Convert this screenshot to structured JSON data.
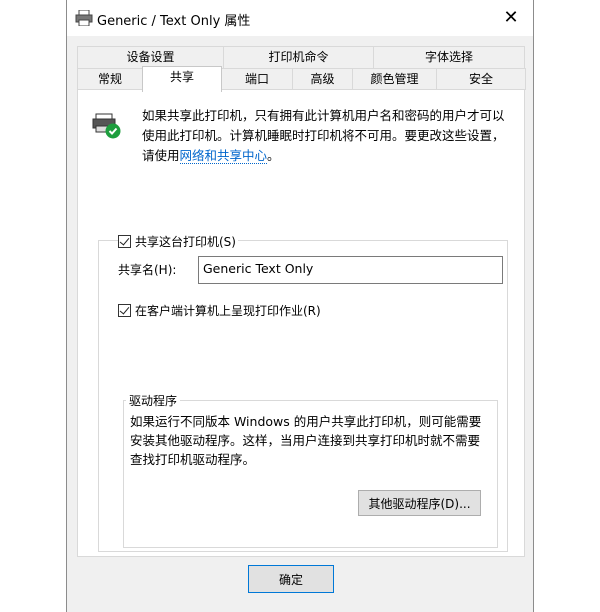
{
  "window": {
    "title": "Generic / Text Only 属性",
    "close_glyph": "✕"
  },
  "tabs_top": [
    "设备设置",
    "打印机命令",
    "字体选择"
  ],
  "tabs_bottom": [
    "常规",
    "共享",
    "端口",
    "高级",
    "颜色管理",
    "安全"
  ],
  "active_tab": "共享",
  "intro": {
    "text": "如果共享此打印机，只有拥有此计算机用户名和密码的用户才可以使用此打印机。计算机睡眠时打印机将不可用。要更改这些设置，请使用",
    "link": "网络和共享中心",
    "suffix": "。"
  },
  "share": {
    "checkbox_label": "共享这台打印机(S)",
    "name_label": "共享名(H):",
    "name_value": "Generic  Text Only",
    "render_label": "在客户端计算机上呈现打印作业(R)"
  },
  "driver": {
    "title": "驱动程序",
    "text": "如果运行不同版本 Windows 的用户共享此打印机，则可能需要安装其他驱动程序。这样，当用户连接到共享打印机时就不需要查找打印机驱动程序。",
    "button": "其他驱动程序(D)..."
  },
  "footer": {
    "ok": "确定"
  },
  "colors": {
    "link": "#0066cc",
    "ok_border": "#0078d7"
  },
  "icons": {
    "title": "printer-icon",
    "share": "shared-printer-icon"
  }
}
